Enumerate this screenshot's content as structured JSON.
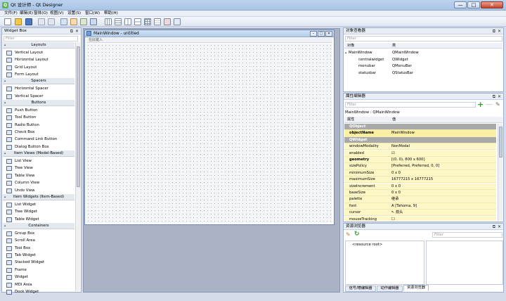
{
  "window": {
    "title": "Qt 设计师 - Qt Designer",
    "min_glyph": "—",
    "max_glyph": "□",
    "close_glyph": "✕"
  },
  "menu": [
    "文件(F)",
    "编辑(E)",
    "窗体(O)",
    "视图(V)",
    "设置(S)",
    "窗口(W)",
    "帮助(H)"
  ],
  "toolbar_icons": [
    "new-icon",
    "open-icon",
    "save-icon",
    "copy-icon",
    "paste-icon",
    "edit-widgets-icon",
    "edit-signals-icon",
    "edit-buddies-icon",
    "edit-taborder-icon",
    "layout-horizontal-icon",
    "layout-vertical-icon",
    "layout-split-horizontal-icon",
    "layout-split-vertical-icon",
    "layout-grid-icon",
    "layout-form-icon",
    "break-layout-icon",
    "adjust-size-icon"
  ],
  "widget_box": {
    "title": "Widget Box",
    "filter_placeholder": "Filter",
    "categories": [
      {
        "name": "Layouts",
        "items": [
          "Vertical Layout",
          "Horizontal Layout",
          "Grid Layout",
          "Form Layout"
        ]
      },
      {
        "name": "Spacers",
        "items": [
          "Horizontal Spacer",
          "Vertical Spacer"
        ]
      },
      {
        "name": "Buttons",
        "items": [
          "Push Button",
          "Tool Button",
          "Radio Button",
          "Check Box",
          "Command Link Button",
          "Dialog Button Box"
        ]
      },
      {
        "name": "Item Views (Model-Based)",
        "items": [
          "List View",
          "Tree View",
          "Table View",
          "Column View",
          "Undo View"
        ]
      },
      {
        "name": "Item Widgets (Item-Based)",
        "items": [
          "List Widget",
          "Tree Widget",
          "Table Widget"
        ]
      },
      {
        "name": "Containers",
        "items": [
          "Group Box",
          "Scroll Area",
          "Tool Box",
          "Tab Widget",
          "Stacked Widget",
          "Frame",
          "Widget",
          "MDI Area",
          "Dock Widget"
        ]
      }
    ]
  },
  "form_window": {
    "title": "MainWindow - untitled",
    "menu_placeholder": "在此键入"
  },
  "object_inspector": {
    "title": "对象查看器",
    "filter_placeholder": "Filter",
    "col_object": "对象",
    "col_class": "类",
    "rows": [
      {
        "object": "MainWindow",
        "class": "QMainWindow",
        "depth": 0
      },
      {
        "object": "centralwidget",
        "class": "QWidget",
        "depth": 1
      },
      {
        "object": "menubar",
        "class": "QMenuBar",
        "depth": 1
      },
      {
        "object": "statusbar",
        "class": "QStatusBar",
        "depth": 1
      }
    ]
  },
  "property_editor": {
    "title": "属性编辑器",
    "filter_placeholder": "Filter",
    "context": "MainWindow : QMainWindow",
    "col_property": "属性",
    "col_value": "值",
    "rows": [
      {
        "k": "QObject",
        "v": "",
        "type": "group"
      },
      {
        "k": "objectName",
        "v": "MainWindow",
        "type": "bold2"
      },
      {
        "k": "QWidget",
        "v": "",
        "type": "group"
      },
      {
        "k": "windowModality",
        "v": "NonModal",
        "type": "y"
      },
      {
        "k": "enabled",
        "v": "☑",
        "type": "y"
      },
      {
        "k": "geometry",
        "v": "[(0, 0), 800 x 600]",
        "type": "bold"
      },
      {
        "k": "sizePolicy",
        "v": "[Preferred, Preferred, 0, 0]",
        "type": "y"
      },
      {
        "k": "minimumSize",
        "v": "0 x 0",
        "type": "y"
      },
      {
        "k": "maximumSize",
        "v": "16777215 x 16777215",
        "type": "y"
      },
      {
        "k": "sizeIncrement",
        "v": "0 x 0",
        "type": "y"
      },
      {
        "k": "baseSize",
        "v": "0 x 0",
        "type": "y"
      },
      {
        "k": "palette",
        "v": "继承",
        "type": "y"
      },
      {
        "k": "font",
        "v": "A  [Tahoma, 9]",
        "type": "y"
      },
      {
        "k": "cursor",
        "v": "↖  箭头",
        "type": "y"
      },
      {
        "k": "mouseTracking",
        "v": "☐",
        "type": "y"
      }
    ]
  },
  "resource_browser": {
    "title": "资源浏览器",
    "filter_placeholder": "Filter",
    "root": "<resource root>",
    "tabs": [
      "信号/槽编辑器",
      "动作编辑器",
      "资源浏览器"
    ]
  }
}
